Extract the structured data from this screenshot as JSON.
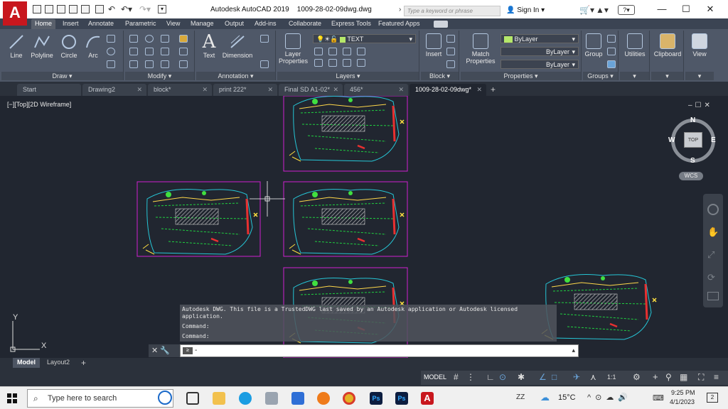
{
  "window": {
    "app_title": "Autodesk AutoCAD 2019",
    "file": "1009-28-02-09dwg.dwg",
    "search_placeholder": "Type a keyword or phrase",
    "sign_in": "Sign In"
  },
  "ribbon_tabs": [
    "Home",
    "Insert",
    "Annotate",
    "Parametric",
    "View",
    "Manage",
    "Output",
    "Add-ins",
    "Collaborate",
    "Express Tools",
    "Featured Apps"
  ],
  "draw": {
    "title": "Draw",
    "line": "Line",
    "polyline": "Polyline",
    "circle": "Circle",
    "arc": "Arc"
  },
  "modify": {
    "title": "Modify"
  },
  "annotation": {
    "title": "Annotation",
    "text": "Text",
    "dimension": "Dimension"
  },
  "layers": {
    "title": "Layers",
    "layer_properties": "Layer Properties",
    "current_layer": "TEXT"
  },
  "block": {
    "title": "Block",
    "insert": "Insert"
  },
  "properties": {
    "title": "Properties",
    "match": "Match Properties",
    "color": "ByLayer",
    "linetype": "ByLayer",
    "lineweight": "ByLayer"
  },
  "groups": {
    "title": "Groups",
    "group": "Group"
  },
  "utilities": "Utilities",
  "clipboard": "Clipboard",
  "view": "View",
  "doc_tabs": [
    "Start",
    "Drawing2",
    "block*",
    "print 222*",
    "Final SD A1-02*",
    "456*",
    "1009-28-02-09dwg*"
  ],
  "viewport_label": "[−][Top][2D Wireframe]",
  "viewcube": {
    "n": "N",
    "s": "S",
    "e": "E",
    "w": "W",
    "top": "TOP",
    "wcs": "WCS"
  },
  "ucs": {
    "x": "X",
    "y": "Y"
  },
  "command": {
    "history_1": "Autodesk DWG.  This file is a TrustedDWG last saved by an Autodesk application or Autodesk licensed application.",
    "history_2": "Command:",
    "history_3": "Command:",
    "prompt": "-"
  },
  "layout_tabs": [
    "Model",
    "Layout2"
  ],
  "status": {
    "model": "MODEL",
    "scale": "1:1"
  },
  "taskbar": {
    "search": "Type here to search",
    "weather": "15°C",
    "time": "9:25 PM",
    "date": "4/1/2023",
    "lang": "ZZ",
    "notif": "2"
  },
  "colors": {
    "accent": "#c8171e",
    "canvas": "#212630",
    "ribbon": "#4f5868",
    "layer_swatch": "#b5e86a"
  }
}
